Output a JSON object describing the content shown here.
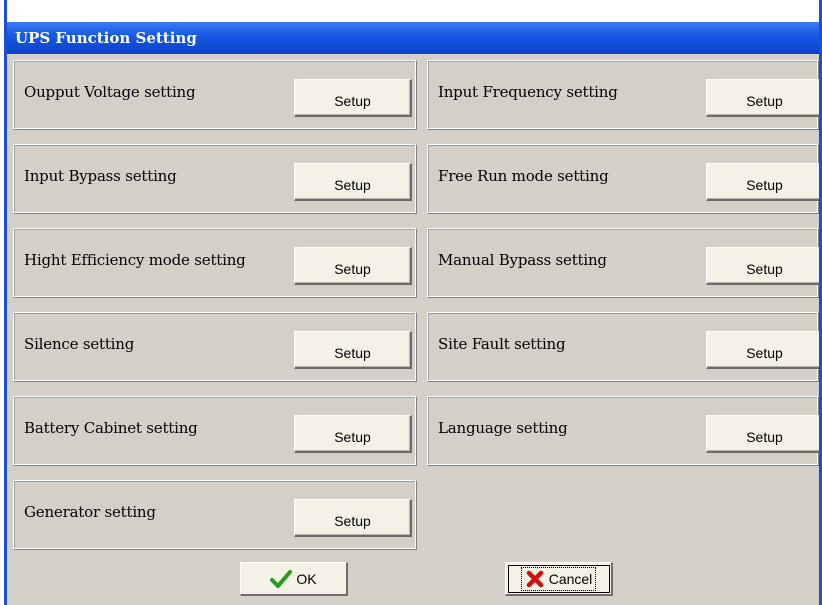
{
  "window": {
    "title": "UPS Function Setting"
  },
  "settings_left": [
    {
      "label": "Oupput Voltage setting",
      "button": "Setup"
    },
    {
      "label": "Input Bypass setting",
      "button": "Setup"
    },
    {
      "label": "Hight Efficiency mode setting",
      "button": "Setup"
    },
    {
      "label": "Silence setting",
      "button": "Setup"
    },
    {
      "label": "Battery Cabinet setting",
      "button": "Setup"
    },
    {
      "label": "Generator setting",
      "button": "Setup"
    }
  ],
  "settings_right": [
    {
      "label": "Input Frequency setting",
      "button": "Setup"
    },
    {
      "label": "Free Run mode setting",
      "button": "Setup"
    },
    {
      "label": "Manual Bypass setting",
      "button": "Setup"
    },
    {
      "label": "Site Fault setting",
      "button": "Setup"
    },
    {
      "label": "Language setting",
      "button": "Setup"
    }
  ],
  "footer": {
    "ok_label": "OK",
    "cancel_label": "Cancel",
    "ok_icon": "checkmark-icon",
    "cancel_icon": "red-x-icon",
    "ok_icon_color": "#2a9a1a",
    "cancel_icon_color": "#d01010"
  },
  "colors": {
    "titlebar": "#1a5ae3",
    "dialog_background": "#d4d0c8"
  }
}
